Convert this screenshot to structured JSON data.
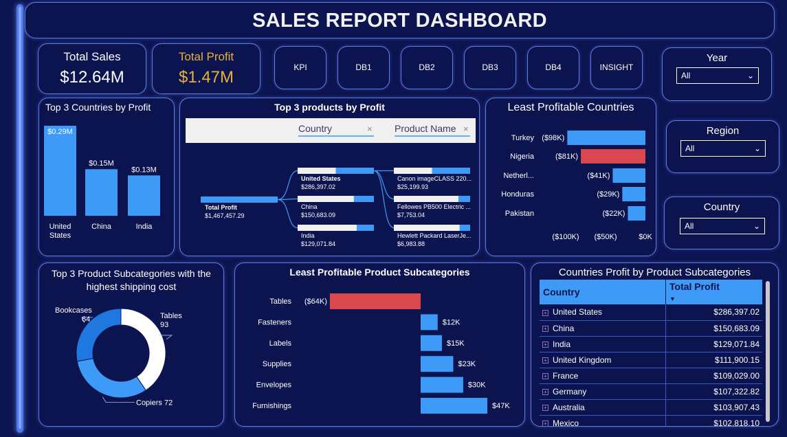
{
  "header": {
    "title": "SALES REPORT DASHBOARD"
  },
  "kpis": {
    "total_sales": {
      "label": "Total Sales",
      "value": "$12.64M"
    },
    "total_profit": {
      "label": "Total Profit",
      "value": "$1.47M"
    }
  },
  "nav": [
    "KPI",
    "DB1",
    "DB2",
    "DB3",
    "DB4",
    "INSIGHT"
  ],
  "slicers": {
    "year": {
      "label": "Year",
      "value": "All"
    },
    "region": {
      "label": "Region",
      "value": "All"
    },
    "country": {
      "label": "Country",
      "value": "All"
    }
  },
  "colors": {
    "bar": "#3d9bf7",
    "negative": "#d9474f",
    "panel_bg": "#0c1450",
    "border": "#5f7ce6",
    "gold": "#e8b13a"
  },
  "chart_data": [
    {
      "id": "top3_countries",
      "type": "bar",
      "title": "Top 3 Countries by Profit",
      "categories": [
        "United States",
        "China",
        "India"
      ],
      "values": [
        0.29,
        0.15,
        0.13
      ],
      "data_labels": [
        "$0.29M",
        "$0.15M",
        "$0.13M"
      ]
    },
    {
      "id": "top3_products",
      "type": "decomposition-tree",
      "title": "Top 3 products by Profit",
      "fields": [
        "Country",
        "Product Name"
      ],
      "root": {
        "label": "Total Profit",
        "value": "$1,467,457.29",
        "amount": 1467457.29
      },
      "level1": [
        {
          "label": "United States",
          "value": "$286,397.02",
          "amount": 286397.02
        },
        {
          "label": "China",
          "value": "$150,683.09",
          "amount": 150683.09
        },
        {
          "label": "India",
          "value": "$129,071.84",
          "amount": 129071.84
        }
      ],
      "level2": [
        {
          "label": "Canon imageCLASS 220...",
          "value": "$25,199.93",
          "amount": 25199.93
        },
        {
          "label": "Fellowes PB500 Electric ...",
          "value": "$7,753.04",
          "amount": 7753.04
        },
        {
          "label": "Hewlett Packard LaserJe...",
          "value": "$6,983.88",
          "amount": 6983.88
        }
      ]
    },
    {
      "id": "least_profitable_countries",
      "type": "bar",
      "orientation": "horizontal",
      "title": "Least Profitable Countries",
      "categories": [
        "Turkey",
        "Nigeria",
        "Netherl...",
        "Honduras",
        "Pakistan"
      ],
      "values": [
        -98,
        -81,
        -41,
        -29,
        -22
      ],
      "data_labels": [
        "($98K)",
        "($81K)",
        "($41K)",
        "($29K)",
        "($22K)"
      ],
      "highlight_index": 1,
      "xlim": [
        -100,
        0
      ],
      "x_ticks": [
        "($100K)",
        "($50K)",
        "$0K"
      ]
    },
    {
      "id": "shipping_cost_subcategories",
      "type": "pie",
      "donut": true,
      "title": "Top 3 Product Subcategories with the highest shipping cost",
      "slices": [
        {
          "label": "Tables",
          "value": 93,
          "color": "#ffffff"
        },
        {
          "label": "Copiers",
          "value": 72,
          "color": "#3d9bf7"
        },
        {
          "label": "Bookcases",
          "value": 64,
          "color": "#1f78e0"
        }
      ]
    },
    {
      "id": "least_profitable_subcategories",
      "type": "bar",
      "orientation": "horizontal",
      "title": "Least Profitable Product Subcategories",
      "categories": [
        "Tables",
        "Fasteners",
        "Labels",
        "Supplies",
        "Envelopes",
        "Furnishings"
      ],
      "values": [
        -64,
        12,
        15,
        23,
        30,
        47
      ],
      "data_labels": [
        "($64K)",
        "$12K",
        "$15K",
        "$23K",
        "$30K",
        "$47K"
      ]
    },
    {
      "id": "countries_profit_table",
      "type": "table",
      "title": "Countries Profit by Product Subcategories",
      "columns": [
        "Country",
        "Total Profit"
      ],
      "rows": [
        [
          "United States",
          "$286,397.02"
        ],
        [
          "China",
          "$150,683.09"
        ],
        [
          "India",
          "$129,071.84"
        ],
        [
          "United Kingdom",
          "$111,900.15"
        ],
        [
          "France",
          "$109,029.00"
        ],
        [
          "Germany",
          "$107,322.82"
        ],
        [
          "Australia",
          "$103,907.43"
        ],
        [
          "Mexico",
          "$102,818.10"
        ]
      ]
    }
  ]
}
